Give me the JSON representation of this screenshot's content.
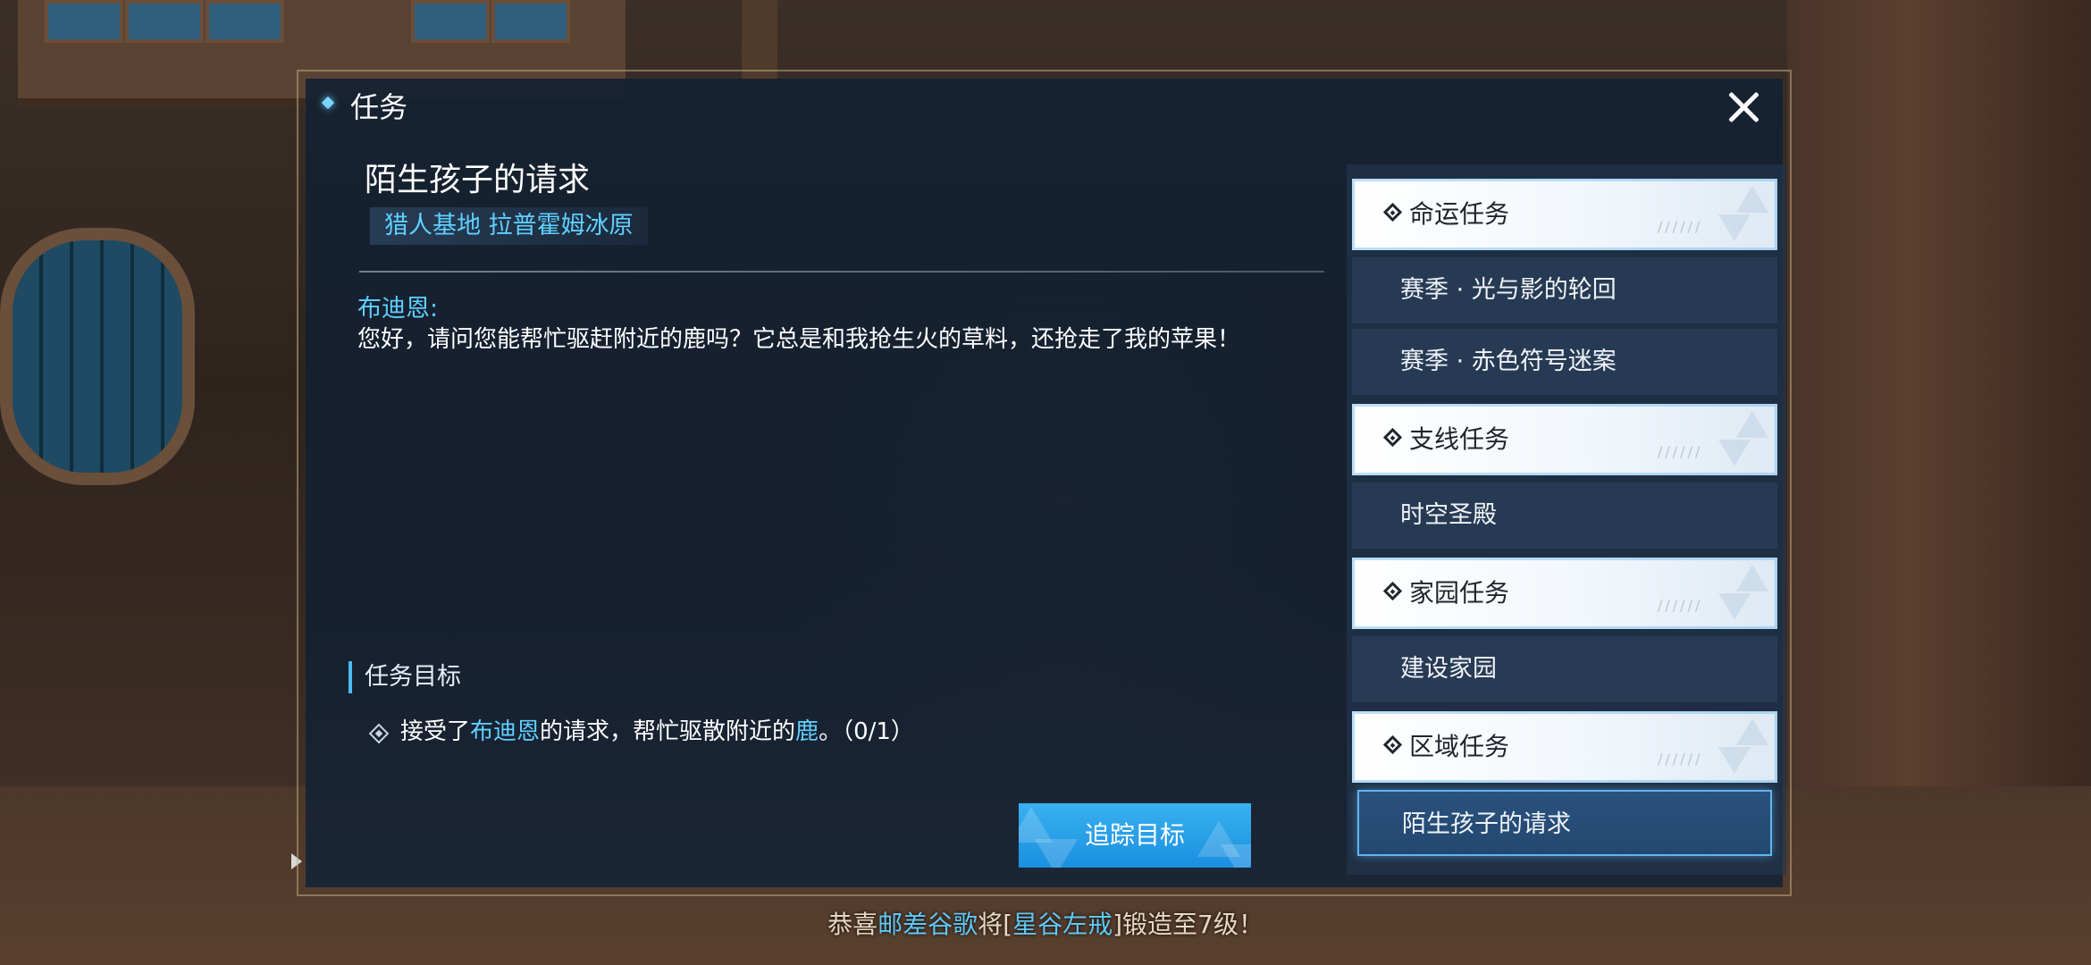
{
  "dialog": {
    "title": "任务",
    "quest_title": "陌生孩子的请求",
    "location": "猎人基地 拉普霍姆冰原",
    "speaker": "布迪恩:",
    "dialogue": "您好，请问您能帮忙驱赶附近的鹿吗？它总是和我抢生火的草料，还抢走了我的苹果！",
    "objective_header": "任务目标",
    "objective": {
      "part1": "接受了",
      "npc": "布迪恩",
      "part2": "的请求，帮忙驱散附近的",
      "target": "鹿",
      "part3": "。（0/1）"
    },
    "track_button": "追踪目标"
  },
  "side_panel": {
    "categories": [
      {
        "label": "命运任务",
        "dashes": "//////",
        "items": [
          "赛季 · 光与影的轮回",
          "赛季 · 赤色符号迷案"
        ]
      },
      {
        "label": "支线任务",
        "dashes": "//////",
        "items": [
          "时空圣殿"
        ]
      },
      {
        "label": "家园任务",
        "dashes": "//////",
        "items": [
          "建设家园"
        ]
      },
      {
        "label": "区域任务",
        "dashes": "//////",
        "items": [
          "陌生孩子的请求"
        ]
      }
    ],
    "active_item": "陌生孩子的请求"
  },
  "broadcast": {
    "part1": "恭喜",
    "player": "邮差谷歌",
    "part2": "将[",
    "item": "星谷左戒",
    "part3": "]锻造至7级！"
  },
  "colors": {
    "accent": "#5fd0ff",
    "button": "#2aa0e8",
    "panel": "#14213a"
  }
}
